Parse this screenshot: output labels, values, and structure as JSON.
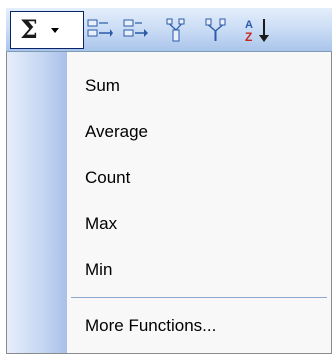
{
  "toolbar": {
    "autosum_icon": "sigma-icon",
    "autosum_glyph": "Σ",
    "buttons": [
      {
        "name": "indent-rows-icon"
      },
      {
        "name": "outdent-rows-icon"
      },
      {
        "name": "group-icon"
      },
      {
        "name": "ungroup-icon"
      },
      {
        "name": "sort-ascending-icon",
        "glyph_top": "A",
        "glyph_bottom": "Z"
      }
    ]
  },
  "menu": {
    "items": [
      {
        "label": "Sum"
      },
      {
        "label": "Average"
      },
      {
        "label": "Count"
      },
      {
        "label": "Max"
      },
      {
        "label": "Min"
      },
      {
        "label": "More Functions..."
      }
    ]
  },
  "colors": {
    "toolbar_top": "#e4eefb",
    "toolbar_bottom": "#a9c4ea",
    "gutter": "#c4d6f2",
    "menu_bg": "#f8f8f8",
    "highlight_border": "#0a246a",
    "icon_blue": "#2b5aa8"
  }
}
